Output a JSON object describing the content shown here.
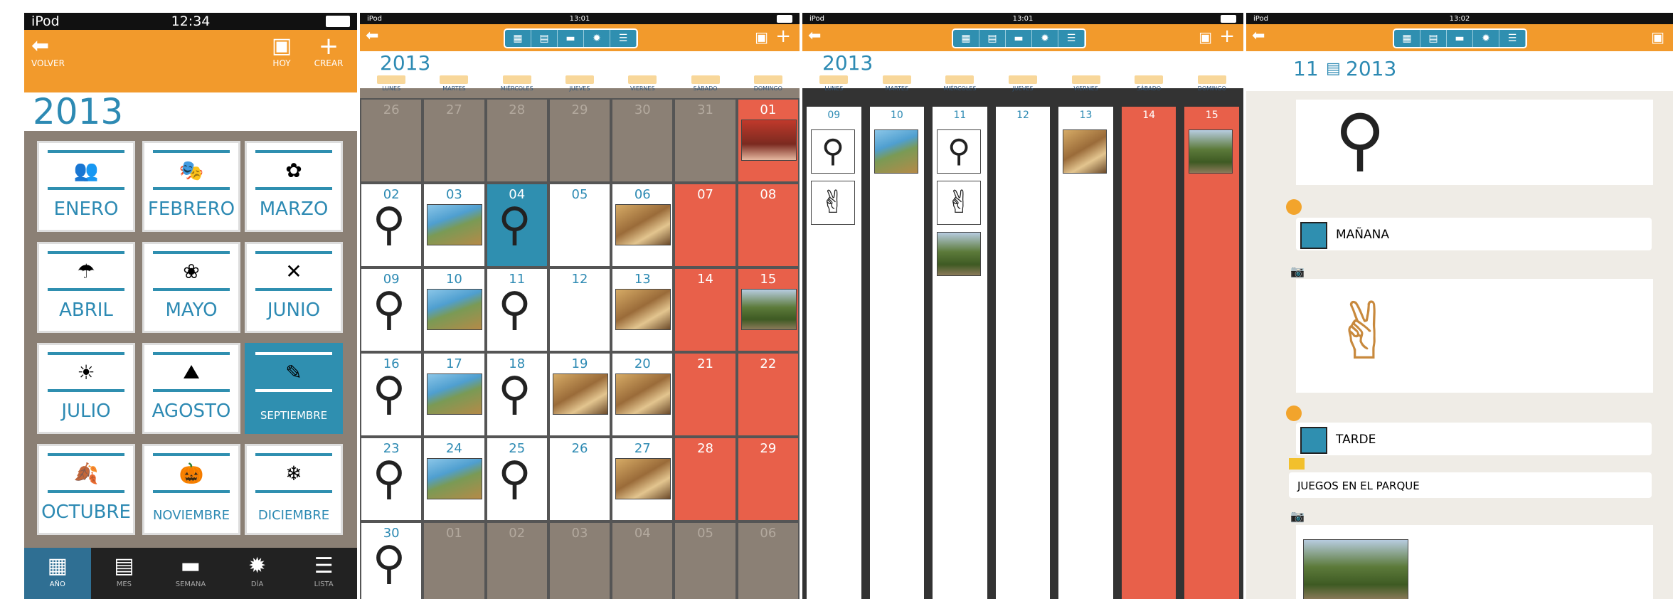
{
  "screen1": {
    "status": {
      "left": "iPod",
      "time": "12:34"
    },
    "toolbar": {
      "back_label": "VOLVER",
      "today_label": "HOY",
      "create_label": "CREAR"
    },
    "year": "2013",
    "months": [
      {
        "name": "ENERO",
        "icon": "two-people-icon",
        "glyph": "👥"
      },
      {
        "name": "FEBRERO",
        "icon": "mask-icon",
        "glyph": "🎭"
      },
      {
        "name": "MARZO",
        "icon": "flower-icon",
        "glyph": "✿"
      },
      {
        "name": "ABRIL",
        "icon": "rain-icon",
        "glyph": "☂"
      },
      {
        "name": "MAYO",
        "icon": "flowers-icon",
        "glyph": "❀"
      },
      {
        "name": "JUNIO",
        "icon": "crossed-icon",
        "glyph": "✕"
      },
      {
        "name": "JULIO",
        "icon": "beach-icon",
        "glyph": "☀"
      },
      {
        "name": "AGOSTO",
        "icon": "mountain-icon",
        "glyph": "⛰"
      },
      {
        "name": "SEPTIEMBRE",
        "icon": "reading-icon",
        "glyph": "✎"
      },
      {
        "name": "OCTUBRE",
        "icon": "leaf-icon",
        "glyph": "🍂"
      },
      {
        "name": "NOVIEMBRE",
        "icon": "pumpkin-icon",
        "glyph": "🎃"
      },
      {
        "name": "DICIEMBRE",
        "icon": "snowflake-icon",
        "glyph": "❄"
      }
    ],
    "selected_month": "SEPTIEMBRE",
    "tabs": [
      "AÑO",
      "MES",
      "SEMANA",
      "DÍA",
      "LISTA"
    ]
  },
  "screen2": {
    "status": {
      "left": "iPod",
      "time": "13:01"
    },
    "year": "2013",
    "weekdays": [
      "LUNES",
      "MARTES",
      "MIÉRCOLES",
      "JUEVES",
      "VIERNES",
      "SÁBADO",
      "DOMINGO"
    ],
    "weeks": [
      [
        "26",
        "27",
        "28",
        "29",
        "30",
        "31",
        "01"
      ],
      [
        "02",
        "03",
        "04",
        "05",
        "06",
        "07",
        "08"
      ],
      [
        "09",
        "10",
        "11",
        "12",
        "13",
        "14",
        "15"
      ],
      [
        "16",
        "17",
        "18",
        "19",
        "20",
        "21",
        "22"
      ],
      [
        "23",
        "24",
        "25",
        "26",
        "27",
        "28",
        "29"
      ],
      [
        "30",
        "01",
        "02",
        "03",
        "04",
        "05",
        "06"
      ]
    ]
  },
  "screen3": {
    "status": {
      "left": "iPod",
      "time": "13:01"
    },
    "year": "2013",
    "weekdays": [
      "LUNES",
      "MARTES",
      "MIÉRCOLES",
      "JUEVES",
      "VIERNES",
      "SÁBADO",
      "DOMINGO"
    ],
    "days": [
      "09",
      "10",
      "11",
      "12",
      "13",
      "14",
      "15"
    ]
  },
  "screen4": {
    "status": {
      "left": "iPod",
      "time": "13:02"
    },
    "day": "11",
    "year": "2013",
    "items": [
      {
        "label": "MAÑANA"
      },
      {
        "label": "TARDE"
      },
      {
        "label": "JUEGOS EN EL PARQUE"
      }
    ]
  },
  "colors": {
    "orange": "#f29a2c",
    "blue": "#2f8fb0",
    "weekend": "#e8604a",
    "gray": "#8b8075"
  }
}
